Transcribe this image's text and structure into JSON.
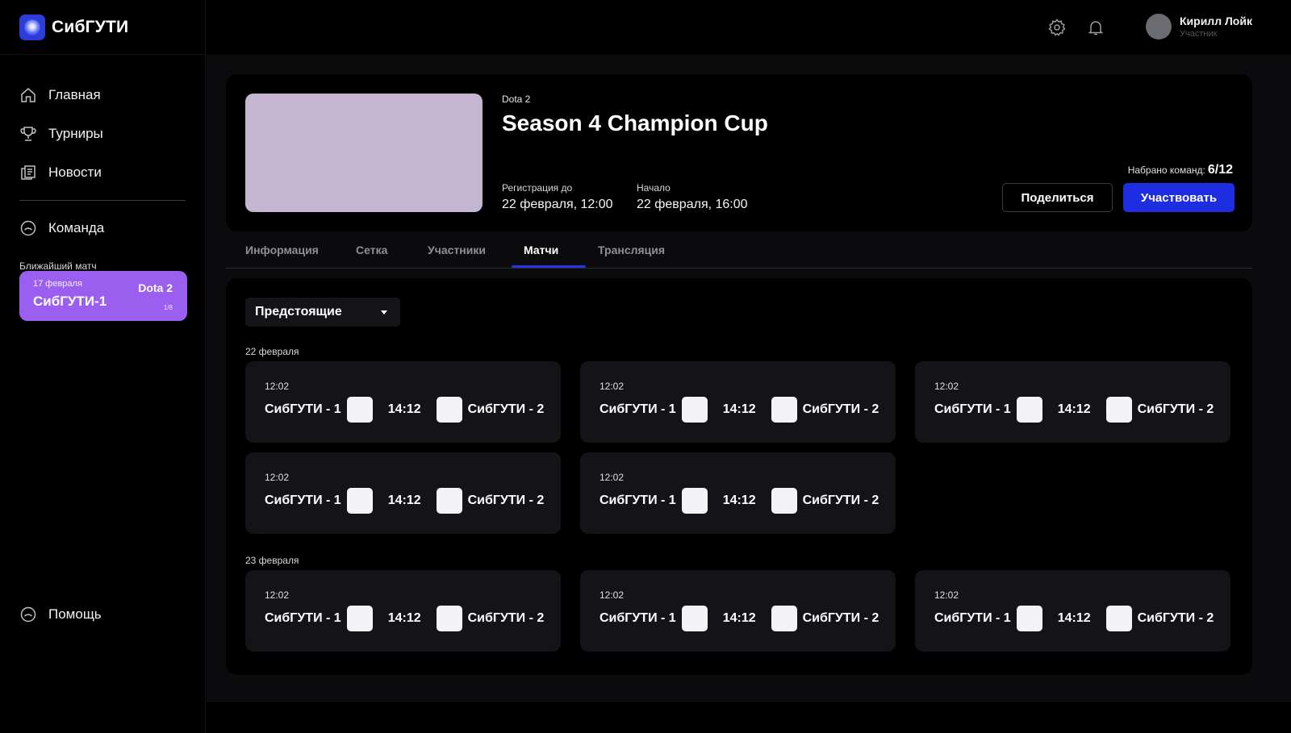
{
  "brand": {
    "name": "СибГУТИ"
  },
  "nav": {
    "items": [
      {
        "label": "Главная",
        "icon": "home-icon"
      },
      {
        "label": "Турниры",
        "icon": "trophy-icon"
      },
      {
        "label": "Новости",
        "icon": "news-icon"
      },
      {
        "label": "Команда",
        "icon": "team-icon"
      }
    ],
    "help": {
      "label": "Помощь",
      "icon": "help-icon"
    }
  },
  "next_match": {
    "label": "Ближайший матч",
    "date": "17 февраля",
    "team": "СибГУТИ-1",
    "game": "Dota 2",
    "round": "1/8",
    "color": "#9b5ff0"
  },
  "user": {
    "name": "Кирилл Лойк",
    "role": "Участник"
  },
  "tournament": {
    "game": "Dota 2",
    "title": "Season 4 Champion Cup",
    "reg_label": "Регистрация до",
    "reg_value": "22 февраля, 12:00",
    "start_label": "Начало",
    "start_value": "22 февраля, 16:00",
    "teams_label": "Набрано команд:",
    "teams_value": "6/12",
    "share_label": "Поделиться",
    "join_label": "Участвовать",
    "accent": "#1f2de0"
  },
  "tabs": [
    {
      "label": "Информация",
      "active": false
    },
    {
      "label": "Сетка",
      "active": false
    },
    {
      "label": "Участники",
      "active": false
    },
    {
      "label": "Матчи",
      "active": true
    },
    {
      "label": "Трансляция",
      "active": false
    }
  ],
  "filter": {
    "value": "Предстоящие"
  },
  "days": [
    {
      "label": "22 февраля",
      "matches": [
        {
          "time": "12:02",
          "team1": "СибГУТИ - 1",
          "score": "14:12",
          "team2": "СибГУТИ - 2"
        },
        {
          "time": "12:02",
          "team1": "СибГУТИ - 1",
          "score": "14:12",
          "team2": "СибГУТИ - 2"
        },
        {
          "time": "12:02",
          "team1": "СибГУТИ - 1",
          "score": "14:12",
          "team2": "СибГУТИ - 2"
        },
        {
          "time": "12:02",
          "team1": "СибГУТИ - 1",
          "score": "14:12",
          "team2": "СибГУТИ - 2"
        },
        {
          "time": "12:02",
          "team1": "СибГУТИ - 1",
          "score": "14:12",
          "team2": "СибГУТИ - 2"
        }
      ]
    },
    {
      "label": "23 февраля",
      "matches": [
        {
          "time": "12:02",
          "team1": "СибГУТИ - 1",
          "score": "14:12",
          "team2": "СибГУТИ - 2"
        },
        {
          "time": "12:02",
          "team1": "СибГУТИ - 1",
          "score": "14:12",
          "team2": "СибГУТИ - 2"
        },
        {
          "time": "12:02",
          "team1": "СибГУТИ - 1",
          "score": "14:12",
          "team2": "СибГУТИ - 2"
        }
      ]
    }
  ]
}
